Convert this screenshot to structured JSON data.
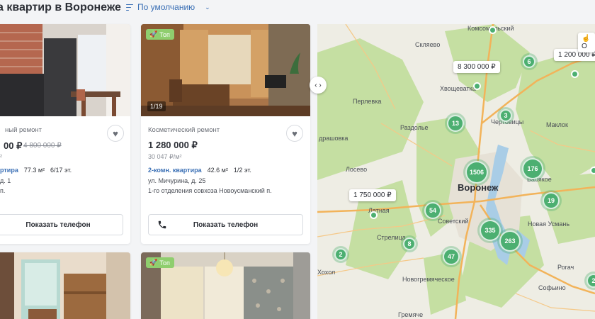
{
  "header": {
    "title": "а квартир в Воронеже",
    "sort_label": "По умолчанию"
  },
  "cards": [
    {
      "repair": "ный ремонт",
      "price": "00 ₽",
      "old_price": "4 800 000 ₽",
      "ppm": "²",
      "type": "ртира",
      "area": "77.3 м²",
      "floor": "6/17 эт.",
      "address1": "д. 1",
      "address2": "п.",
      "phone": "Показать телефон"
    },
    {
      "badge": "Топ",
      "counter": "1/19",
      "repair": "Косметический ремонт",
      "price": "1 280 000 ₽",
      "ppm": "30 047 ₽/м²",
      "type": "2-комн. квартира",
      "area": "42.6 м²",
      "floor": "1/2 эт.",
      "address1": "ул. Мичурина, д. 25",
      "address2": "1-го отделения совхоза Новоусманский п.",
      "phone": "Показать телефон"
    },
    {},
    {
      "badge": "Топ"
    }
  ],
  "map": {
    "city": "Воронеж",
    "places": [
      "Комсомольский",
      "Скляево",
      "Хвощеватка",
      "Перлевка",
      "Чертовицы",
      "Маклок",
      "Раздолье",
      "драшовка",
      "Лосево",
      "Латная",
      "Стрелица",
      "Советский",
      "Бабякое",
      "Новая Усмань",
      "Хохол",
      "Новогремяческое",
      "Софьино",
      "Рогач",
      "Гремяче"
    ],
    "clusters": [
      "6",
      "13",
      "3",
      "1506",
      "176",
      "19",
      "54",
      "335",
      "263",
      "8",
      "47",
      "2",
      "2"
    ],
    "bubbles": [
      "8 300 000 ₽",
      "1 200 000 ₽",
      "1 750 000 ₽"
    ],
    "control": "О"
  }
}
